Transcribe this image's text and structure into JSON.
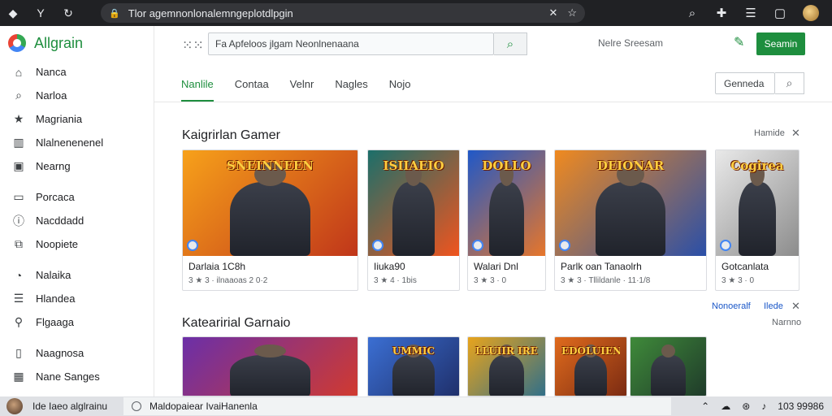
{
  "browser": {
    "url": "Tlor agemnonlonalemngeplotdlpgin",
    "top_icons": [
      "color-square-icon",
      "y-icon",
      "refresh-icon"
    ],
    "right_icons": [
      "search-icon",
      "extension-icon",
      "menu-icon",
      "window-icon"
    ]
  },
  "sidebar": {
    "brand": "Allgrain",
    "items": [
      {
        "label": "Nanca",
        "icon": "home-icon",
        "glyph": "⌂"
      },
      {
        "label": "Narloa",
        "icon": "search-icon",
        "glyph": "⌕"
      },
      {
        "label": "Magriania",
        "icon": "star-icon",
        "glyph": "★"
      },
      {
        "label": "Nlalnenenenel",
        "icon": "chart-icon",
        "glyph": "▥"
      },
      {
        "label": "Nearng",
        "icon": "square-icon",
        "glyph": "▣"
      },
      {
        "label": "Porcaca",
        "icon": "card-icon",
        "glyph": "▭"
      },
      {
        "label": "Nacddadd",
        "icon": "info-icon",
        "glyph": "ⓘ"
      },
      {
        "label": "Noopiete",
        "icon": "external-icon",
        "glyph": "⧉"
      },
      {
        "label": "Nalaika",
        "icon": "clock-icon",
        "glyph": "◔"
      },
      {
        "label": "Hlandea",
        "icon": "list-icon",
        "glyph": "☰"
      },
      {
        "label": "Flgaaga",
        "icon": "pin-icon",
        "glyph": "⚲"
      },
      {
        "label": "Naagnosa",
        "icon": "doc-icon",
        "glyph": "▯"
      },
      {
        "label": "Nane Sanges",
        "icon": "grid-icon",
        "glyph": "▦"
      }
    ]
  },
  "header": {
    "search_value": "Fa Apfeloos jlgam Neonlnenaana",
    "help": "Nelre Sreesam",
    "signin": "Seamin"
  },
  "tabs": [
    {
      "label": "Nanlile",
      "active": true
    },
    {
      "label": "Contaa",
      "active": false
    },
    {
      "label": "Velnr",
      "active": false
    },
    {
      "label": "Nagles",
      "active": false
    },
    {
      "label": "Nojo",
      "active": false
    }
  ],
  "filter": {
    "value": "Genneda"
  },
  "section1": {
    "title": "Kaigrirlan Gamer",
    "more": "Hamide",
    "cards": [
      {
        "art_title": "SNEINNEEN",
        "name": "Darlaia 1C8h",
        "meta": "3 ★ 3 · ilnaaoas 2 0·2",
        "colors": [
          "#f7a11a",
          "#c0361a"
        ]
      },
      {
        "art_title": "ISIIAEIO",
        "name": "Iiuka90",
        "meta": "3 ★ 4 · 1bis",
        "colors": [
          "#1b6f6a",
          "#f0541e"
        ]
      },
      {
        "art_title": "DOLLO",
        "name": "Walari Dnl",
        "meta": "3 ★ 3 · 0",
        "colors": [
          "#1f58c8",
          "#e7762a"
        ]
      },
      {
        "art_title": "DEIONAR",
        "name": "Parlk oan Tanaolrh",
        "meta": "3 ★ 3 · Tllildanle · 11·1/8",
        "colors": [
          "#f08a1f",
          "#2a4fa8"
        ]
      },
      {
        "art_title": "Cogirea",
        "name": "Gotcanlata",
        "meta": "3 ★ 3 · 0",
        "colors": [
          "#e9e9e9",
          "#8c8c8c"
        ]
      }
    ]
  },
  "section2": {
    "title": "Katearirial Garnaio",
    "links": [
      "Nonoeralf",
      "Ilede"
    ],
    "more": "Narnno",
    "cards": [
      {
        "art_title": "",
        "colors": [
          "#6b2fa8",
          "#d13a2f"
        ]
      },
      {
        "art_title": "UMMIC",
        "colors": [
          "#3b6fd3",
          "#1f2f6a"
        ]
      },
      {
        "art_title": "LLUIIR IRE",
        "colors": [
          "#e8a41c",
          "#2f6f8a"
        ]
      },
      {
        "art_title": "EDOLUIEN",
        "colors": [
          "#e06b1d",
          "#7a2a12"
        ]
      },
      {
        "art_title": "",
        "colors": [
          "#3f8a3a",
          "#1f3a2a"
        ]
      }
    ]
  },
  "statusbar": {
    "user": "Ide Iaeo alglrainu",
    "file": "Maldopaiear IvaiHanenla",
    "time": "103 99986"
  },
  "colors": {
    "accent": "#1e8e3e"
  }
}
